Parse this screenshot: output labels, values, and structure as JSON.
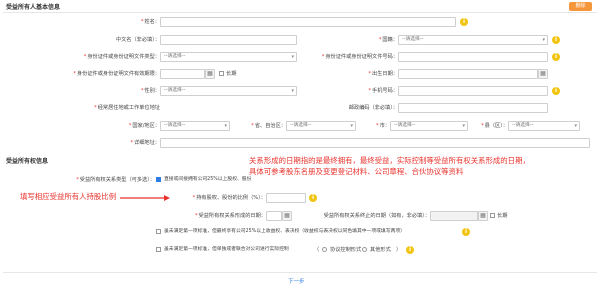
{
  "section_basic": "受益所有人基本信息",
  "delete_label": "删除",
  "fields": {
    "name": "姓名：",
    "cn_name": "中文名（非必填）：",
    "nationality": "国籍：",
    "nationality_value": "--请选择--",
    "id_type": "身份证件或身份证明文件类型：",
    "id_type_value": "--请选择--",
    "id_number": "身份证件或身份证明文件号码：",
    "id_valid": "身份证件或身份证明文件有效期限：",
    "long_term": "长期",
    "birthday": "出生日期：",
    "gender": "性别：",
    "gender_value": "--请选择--",
    "phone": "手机号码：",
    "address_label": "经常居住地或工作单位地址",
    "postcode": "邮政编码（非必填）：",
    "country": "国家/地区：",
    "country_value": "--请选择--",
    "province": "省、自治区：",
    "province_value": "--请选择--",
    "city": "市：",
    "city_value": "--请选择--",
    "county": "县（区）：",
    "county_value": "--请选择--",
    "detail": "详细地址："
  },
  "section_type": "受益所有权信息",
  "type_label": "受益所有权关系类型（可多选）：",
  "option1": "直接或间接拥有公司25%以上股权、股份",
  "ratio_label": "持有股权、股份的比例（%）：",
  "form_date_label": "受益所有权关系形成的日期：",
  "end_date_label": "受益所有权关系终止的日期（如有，非必填）：",
  "long_term": "长期",
  "option2": "虽未满足第一项标准，但最终享有公司25%以上收益权、表决权（收益权与表决权以同色填其中一项或填写两项）",
  "option3": "虽未满足第一项标准，但单独或者联合对公司进行实际控制",
  "radio1": "协议控制形式",
  "radio2": "其他形式",
  "annotation_top_line1": "关系形成的日期指的是最终拥有，最终受益，实际控制等受益所有权关系形成的日期，",
  "annotation_top_line2": "具体可参考股东名册及变更登记材料、公司章程、合伙协议等资料",
  "annotation_left": "填写相应受益所有人持股比例",
  "next_label": "下一步",
  "colors": {
    "accent": "#2f7de1",
    "annotation": "#e8332d",
    "delete": "#f5963a",
    "info": "#f1c40f"
  },
  "icons": [
    "info-icon",
    "calendar-icon",
    "chevron-down-icon",
    "arrow-right-icon"
  ]
}
